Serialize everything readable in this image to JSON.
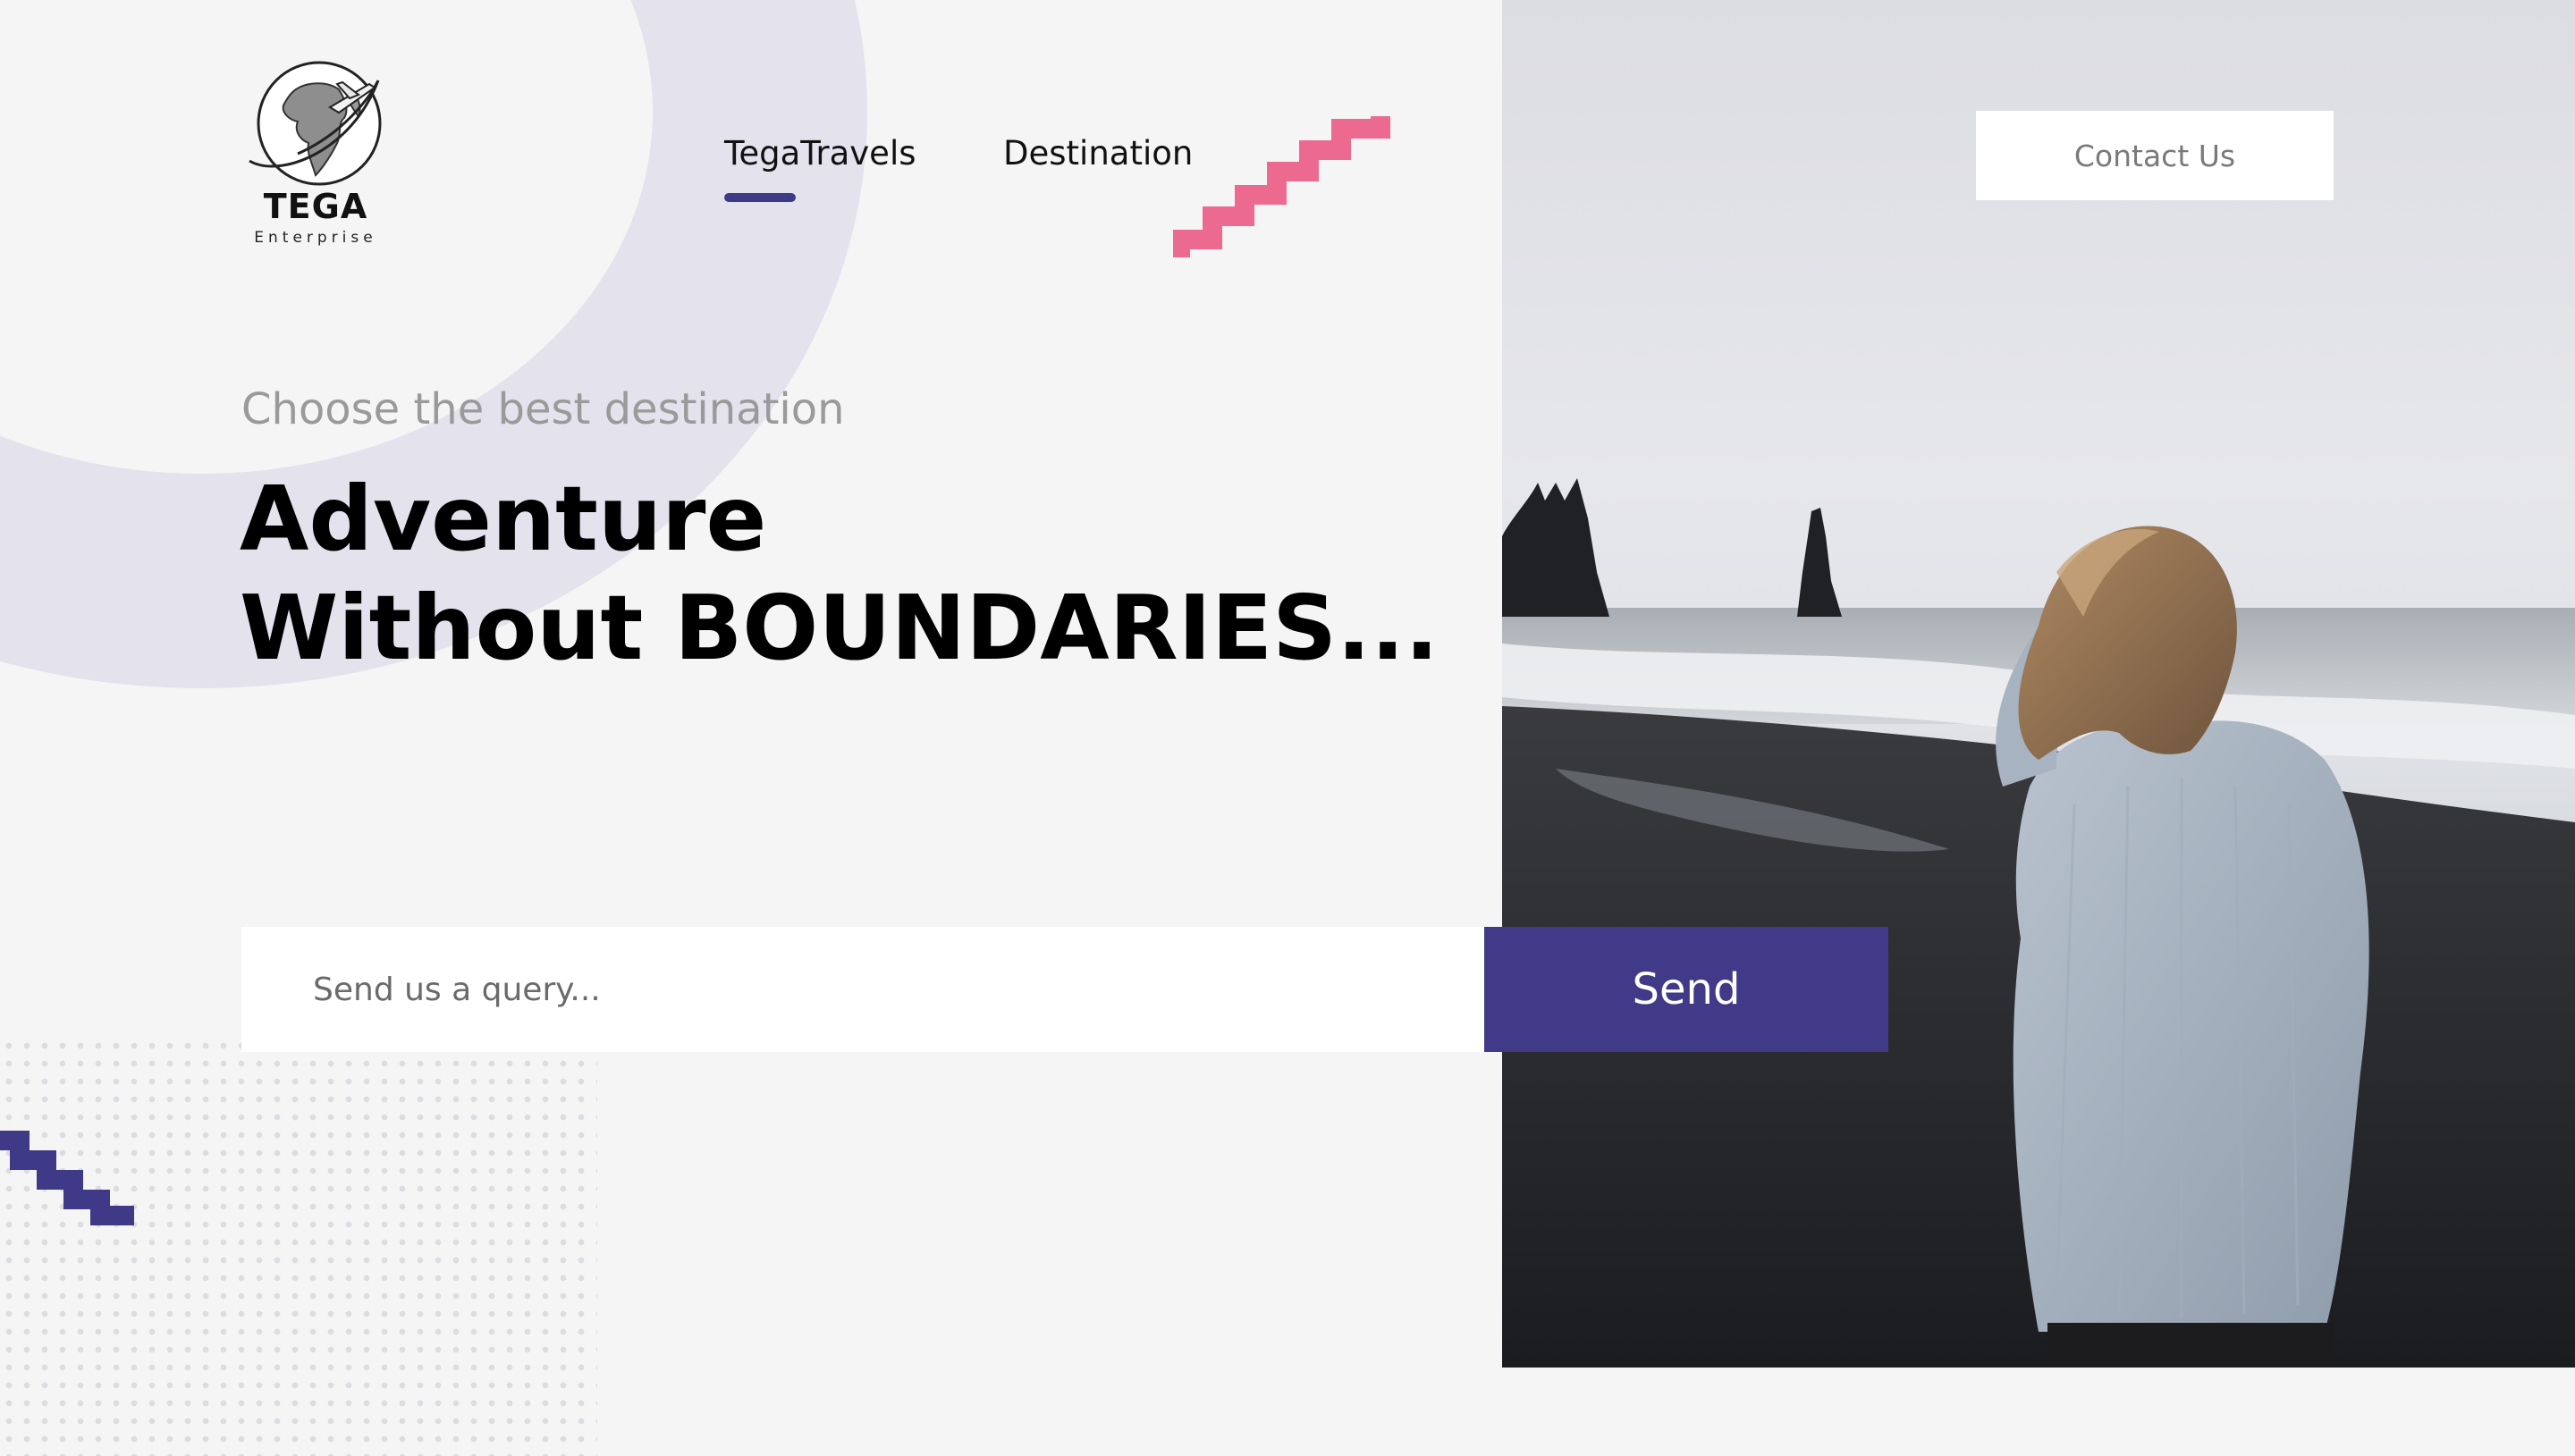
{
  "brand": {
    "name": "TEGA",
    "subtitle": "Enterprise"
  },
  "nav": {
    "items": [
      {
        "label": "TegaTravels",
        "active": true
      },
      {
        "label": "Destination",
        "active": false
      }
    ]
  },
  "header": {
    "contact_label": "Contact Us"
  },
  "hero": {
    "tagline": "Choose the best destination",
    "headline_line1": "Adventure",
    "headline_line2": "Without BOUNDARIES..."
  },
  "query": {
    "placeholder": "Send us a query...",
    "value": "",
    "send_label": "Send"
  },
  "icons": {
    "logo": "globe-airplane-icon",
    "decor_pink": "zigzag-icon",
    "decor_blue": "zigzag-icon"
  },
  "colors": {
    "accent": "#413a88",
    "decor_pink": "#ec6a90",
    "background": "#f5f5f5",
    "arc": "#e4e2ec"
  }
}
